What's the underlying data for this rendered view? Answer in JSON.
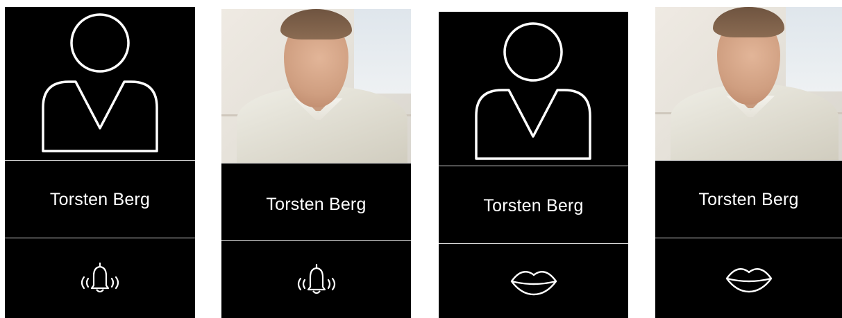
{
  "panels": [
    {
      "name": "Torsten Berg",
      "portrait": "person-outline-icon",
      "action_icon": "ringing-bell-icon"
    },
    {
      "name": "Torsten Berg",
      "portrait": "photo",
      "action_icon": "ringing-bell-icon"
    },
    {
      "name": "Torsten Berg",
      "portrait": "person-outline-icon",
      "action_icon": "lips-icon"
    },
    {
      "name": "Torsten Berg",
      "portrait": "photo",
      "action_icon": "lips-icon"
    }
  ],
  "colors": {
    "background": "#000000",
    "foreground": "#ffffff",
    "divider": "#d8d8d8"
  }
}
